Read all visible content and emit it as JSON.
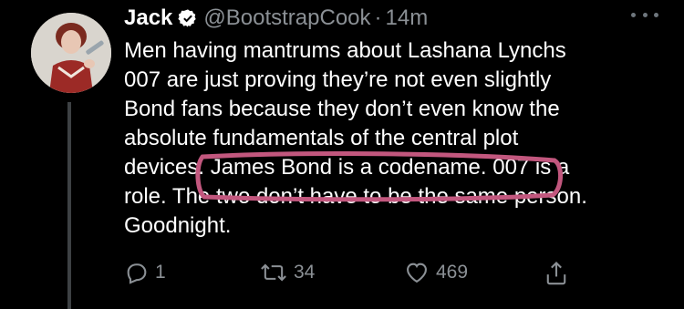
{
  "author": {
    "name": "Jack",
    "handle": "@BootstrapCook",
    "separator": "·",
    "time": "14m",
    "verified": true
  },
  "tweet": {
    "lines": [
      "Men having mantrums about Lashana Lynchs",
      "007 are just proving they’re not even slightly",
      "Bond fans because they don’t even know the",
      "absolute fundamentals of the central plot",
      "devices. James Bond is a codename. 007 is a",
      "role. The two don’t have to be the same person.",
      "Goodnight."
    ]
  },
  "actions": {
    "reply": {
      "icon": "reply-icon",
      "count": "1"
    },
    "retweet": {
      "icon": "retweet-icon",
      "count": "34"
    },
    "like": {
      "icon": "heart-icon",
      "count": "469"
    },
    "share": {
      "icon": "share-icon"
    }
  },
  "colors": {
    "background": "#000000",
    "text": "#ffffff",
    "muted": "#8b9095",
    "verified": "#1d9bf0",
    "annotation": "#c2577e"
  }
}
